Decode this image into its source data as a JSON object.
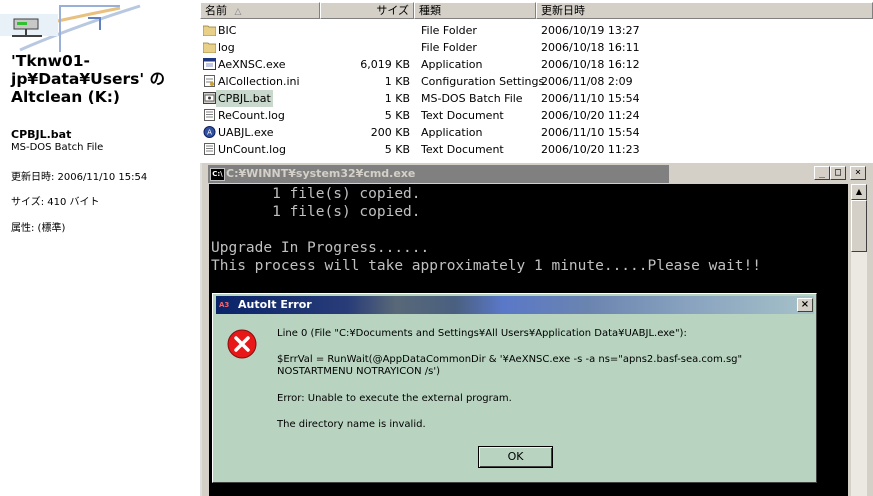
{
  "left": {
    "drive_title": "'Tknw01-jp¥Data¥Users' の Altclean (K:)",
    "selected_name": "CPBJL.bat",
    "selected_type": "MS-DOS Batch File",
    "modified": "更新日時: 2006/11/10 15:54",
    "size": "サイズ: 410 バイト",
    "attributes": "属性: (標準)"
  },
  "filelist": {
    "columns": {
      "name": "名前",
      "sort_indicator": "△",
      "size": "サイズ",
      "type": "種類",
      "modified": "更新日時"
    },
    "rows": [
      {
        "name": "BIC",
        "size": "",
        "type": "File Folder",
        "date": "2006/10/19 13:27",
        "icon": "folder-icon"
      },
      {
        "name": "log",
        "size": "",
        "type": "File Folder",
        "date": "2006/10/18 16:11",
        "icon": "folder-icon"
      },
      {
        "name": "AeXNSC.exe",
        "size": "6,019 KB",
        "type": "Application",
        "date": "2006/10/18 16:12",
        "icon": "exe-icon"
      },
      {
        "name": "AlCollection.ini",
        "size": "1 KB",
        "type": "Configuration Settings",
        "date": "2006/11/08 2:09",
        "icon": "ini-file-icon"
      },
      {
        "name": "CPBJL.bat",
        "size": "1 KB",
        "type": "MS-DOS Batch File",
        "date": "2006/11/10 15:54",
        "icon": "batch-file-icon"
      },
      {
        "name": "ReCount.log",
        "size": "5 KB",
        "type": "Text Document",
        "date": "2006/10/20 11:24",
        "icon": "text-file-icon"
      },
      {
        "name": "UABJL.exe",
        "size": "200 KB",
        "type": "Application",
        "date": "2006/11/10 15:54",
        "icon": "autoit-exe-icon"
      },
      {
        "name": "UnCount.log",
        "size": "5 KB",
        "type": "Text Document",
        "date": "2006/10/20 11:23",
        "icon": "text-file-icon"
      }
    ],
    "selected_index": 4
  },
  "cmd": {
    "title": "C:¥WINNT¥system32¥cmd.exe",
    "icon_text": "C:\\",
    "minimize": "_",
    "maximize": "□",
    "close": "×",
    "lines": [
      "       1 file(s) copied.",
      "       1 file(s) copied.",
      "",
      "Upgrade In Progress......",
      "This process will take approximately 1 minute.....Please wait!!"
    ]
  },
  "dialog": {
    "title": "AutoIt Error",
    "close": "×",
    "line1": "Line 0  (File \"C:¥Documents and Settings¥All Users¥Application Data¥UABJL.exe\"):",
    "line2": "$ErrVal = RunWait(@AppDataCommonDir & '¥AeXNSC.exe -s -a ns=\"apns2.basf-sea.com.sg\" NOSTARTMENU NOTRAYICON /s')",
    "line3": "Error: Unable to execute the external program.",
    "line4": "The directory name is invalid.",
    "ok_label": "OK"
  },
  "colors": {
    "console_bg": "#000000",
    "console_fg": "#c0c0c0",
    "dialog_bg": "#b8d4c0",
    "selection": "#c8d8cc"
  }
}
